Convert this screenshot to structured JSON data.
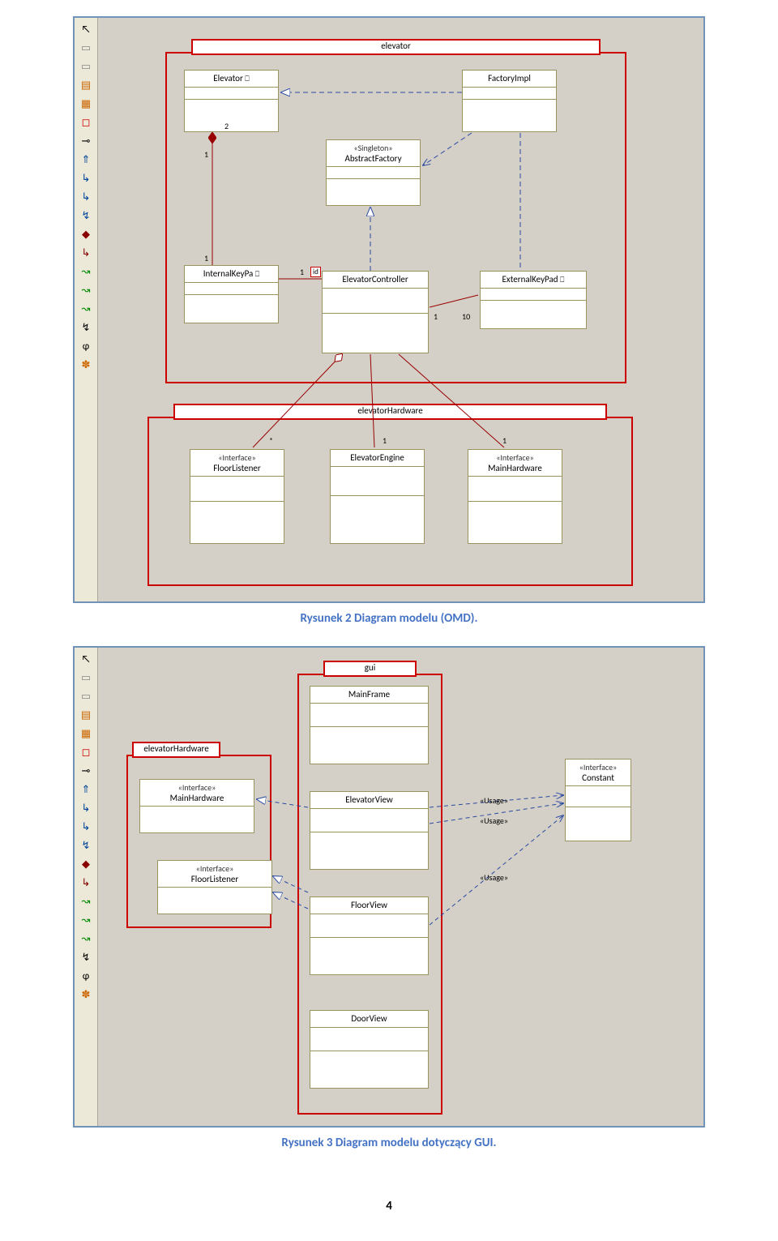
{
  "captions": {
    "fig2": "Rysunek 2 Diagram modelu (OMD).",
    "fig3": "Rysunek 3 Diagram modelu dotyczący GUI."
  },
  "toolbar_icons": [
    "↖",
    "▭",
    "▭",
    "▤",
    "▦",
    "◻",
    "⊸",
    "⇑",
    "↳",
    "↳",
    "↯",
    "◆",
    "↳",
    "↝",
    "↝",
    "↝",
    "↯",
    "ɸ",
    "✽"
  ],
  "diagram1": {
    "packages": {
      "elevator": "elevator",
      "elevatorHardware": "elevatorHardware"
    },
    "classes": {
      "Elevator": {
        "name": "Elevator"
      },
      "FactoryImpl": {
        "name": "FactoryImpl"
      },
      "AbstractFactory": {
        "stereotype": "«Singleton»",
        "name": "AbstractFactory"
      },
      "InternalKeyPa": {
        "name": "InternalKeyPa"
      },
      "ElevatorController": {
        "name": "ElevatorController"
      },
      "ExternalKeyPad": {
        "name": "ExternalKeyPad"
      },
      "FloorListener": {
        "stereotype": "«Interface»",
        "name": "FloorListener"
      },
      "ElevatorEngine": {
        "name": "ElevatorEngine"
      },
      "MainHardware": {
        "stereotype": "«Interface»",
        "name": "MainHardware"
      }
    },
    "mult": {
      "m1": "1",
      "m2": "2",
      "m10": "10",
      "id": "id",
      "star": "*"
    }
  },
  "diagram2": {
    "packages": {
      "gui": "gui",
      "elevatorHardware": "elevatorHardware"
    },
    "classes": {
      "MainFrame": {
        "name": "MainFrame"
      },
      "ElevatorView": {
        "name": "ElevatorView"
      },
      "FloorView": {
        "name": "FloorView"
      },
      "DoorView": {
        "name": "DoorView"
      },
      "MainHardware": {
        "stereotype": "«Interface»",
        "name": "MainHardware"
      },
      "FloorListener": {
        "stereotype": "«Interface»",
        "name": "FloorListener"
      },
      "Constant": {
        "stereotype": "«Interface»",
        "name": "Constant"
      }
    },
    "usage": "«Usage»"
  },
  "pagenum": "4"
}
